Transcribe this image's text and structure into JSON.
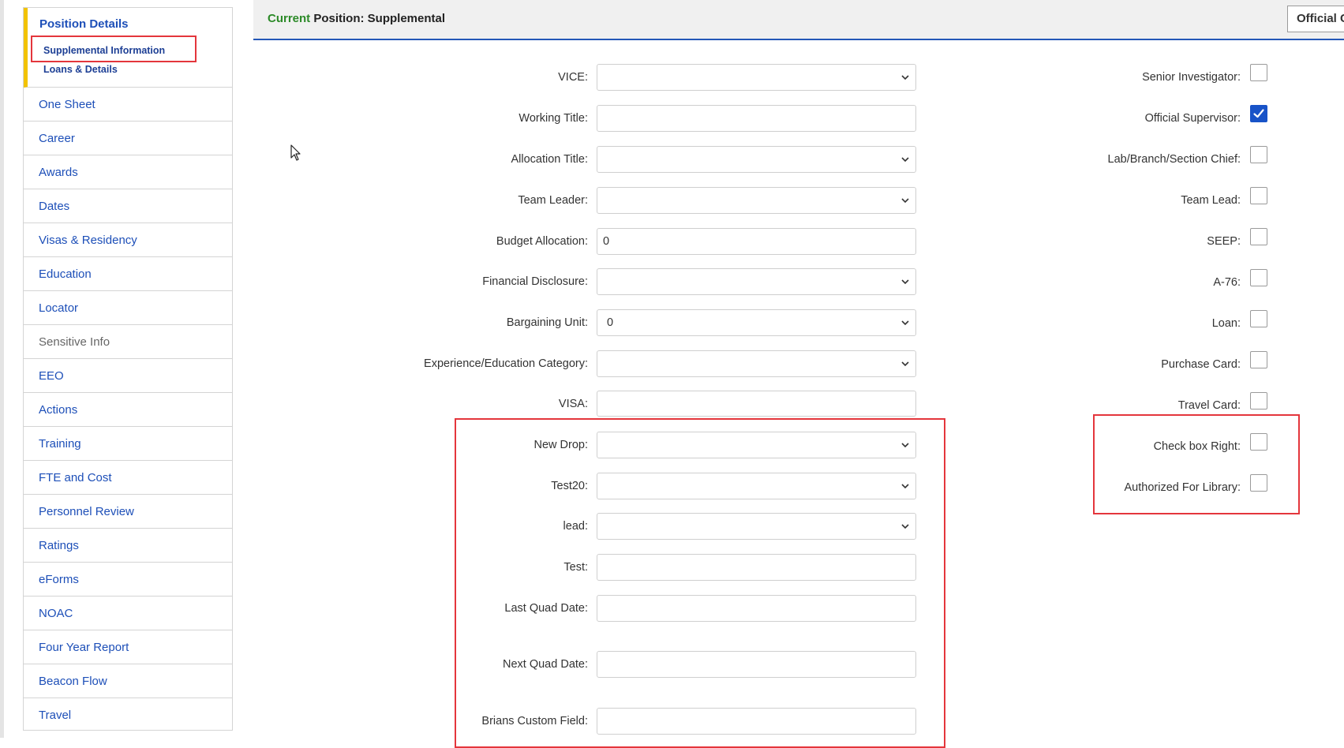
{
  "sidebar": {
    "section_title": "Position Details",
    "section_subitems": [
      "Supplemental Information",
      "Loans & Details"
    ],
    "items": [
      "One Sheet",
      "Career",
      "Awards",
      "Dates",
      "Visas & Residency",
      "Education",
      "Locator",
      "Sensitive Info",
      "EEO",
      "Actions",
      "Training",
      "FTE and Cost",
      "Personnel Review",
      "Ratings",
      "eForms",
      "NOAC",
      "Four Year Report",
      "Beacon Flow",
      "Travel"
    ]
  },
  "header": {
    "current_label": "Current",
    "position_text": "Position: Supplemental",
    "button_label": "Official C"
  },
  "form": {
    "vice": {
      "label": "VICE:",
      "value": ""
    },
    "working_title": {
      "label": "Working Title:",
      "value": ""
    },
    "allocation_title": {
      "label": "Allocation Title:",
      "value": ""
    },
    "team_leader": {
      "label": "Team Leader:",
      "value": ""
    },
    "budget_allocation": {
      "label": "Budget Allocation:",
      "value": "0"
    },
    "financial_disclosure": {
      "label": "Financial Disclosure:",
      "value": ""
    },
    "bargaining_unit": {
      "label": "Bargaining Unit:",
      "value": "0"
    },
    "experience_category": {
      "label": "Experience/Education Category:",
      "value": ""
    },
    "visa": {
      "label": "VISA:",
      "value": ""
    },
    "new_drop": {
      "label": "New Drop:",
      "value": ""
    },
    "test20": {
      "label": "Test20:",
      "value": ""
    },
    "lead": {
      "label": "lead:",
      "value": ""
    },
    "test": {
      "label": "Test:",
      "value": ""
    },
    "last_quad_date": {
      "label": "Last Quad Date:",
      "value": ""
    },
    "next_quad_date": {
      "label": "Next Quad Date:",
      "value": ""
    },
    "brians_custom_field": {
      "label": "Brians Custom Field:",
      "value": ""
    }
  },
  "checkboxes": [
    {
      "label": "Senior Investigator:",
      "checked": false
    },
    {
      "label": "Official Supervisor:",
      "checked": true
    },
    {
      "label": "Lab/Branch/Section Chief:",
      "checked": false
    },
    {
      "label": "Team Lead:",
      "checked": false
    },
    {
      "label": "SEEP:",
      "checked": false
    },
    {
      "label": "A-76:",
      "checked": false
    },
    {
      "label": "Loan:",
      "checked": false
    },
    {
      "label": "Purchase Card:",
      "checked": false
    },
    {
      "label": "Travel Card:",
      "checked": false
    },
    {
      "label": "Check box Right:",
      "checked": false
    },
    {
      "label": "Authorized For Library:",
      "checked": false
    }
  ],
  "colors": {
    "link_blue": "#1d4fb8",
    "section_accent": "#f2c300",
    "current_green": "#2c8a28",
    "highlight_red": "#e4363c",
    "checkbox_blue": "#1853c8"
  },
  "icons": [
    "chevron-down-icon",
    "checkmark-icon",
    "mouse-cursor-icon"
  ]
}
